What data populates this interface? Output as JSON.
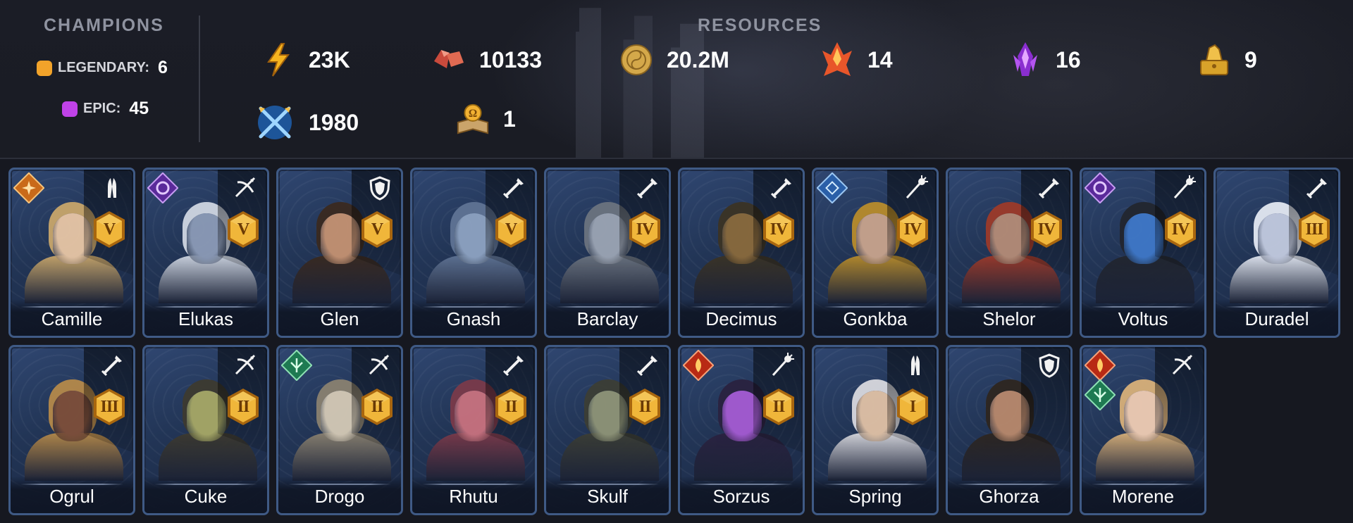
{
  "champions": {
    "title": "CHAMPIONS",
    "legendary_label": "LEGENDARY:",
    "legendary_count": "6",
    "epic_label": "EPIC:",
    "epic_count": "45",
    "legendary_color": "#f2a32a",
    "epic_color": "#c042e8"
  },
  "resources": {
    "title": "RESOURCES",
    "items": [
      {
        "icon": "energy-icon",
        "value": "23K"
      },
      {
        "icon": "ruby-icon",
        "value": "10133"
      },
      {
        "icon": "silver-coin-icon",
        "value": "20.2M"
      },
      {
        "icon": "sacred-shard-icon",
        "value": "14"
      },
      {
        "icon": "void-shard-icon",
        "value": "16"
      },
      {
        "icon": "gold-chest-icon",
        "value": "9"
      },
      {
        "icon": "arena-token-icon",
        "value": "1980"
      },
      {
        "icon": "tome-icon",
        "value": "1"
      }
    ]
  },
  "cards": [
    {
      "name": "Camille",
      "rank": "V",
      "class": "support-icon",
      "affinity": "force-icon",
      "skin": "#e9c7a6",
      "hair": "#c8a66b"
    },
    {
      "name": "Elukas",
      "rank": "V",
      "class": "crossbow-icon",
      "affinity": "magic-icon",
      "skin": "#8c9bb7",
      "hair": "#cfd6e2"
    },
    {
      "name": "Glen",
      "rank": "V",
      "class": "defense-icon",
      "affinity": "",
      "skin": "#c59272",
      "hair": "#3a2a20"
    },
    {
      "name": "Gnash",
      "rank": "V",
      "class": "attack-icon",
      "affinity": "",
      "skin": "#8ea3c2",
      "hair": "#5f7394"
    },
    {
      "name": "Barclay",
      "rank": "IV",
      "class": "attack-icon",
      "affinity": "",
      "skin": "#9ca5b4",
      "hair": "#6b737f"
    },
    {
      "name": "Decimus",
      "rank": "IV",
      "class": "attack-icon",
      "affinity": "",
      "skin": "#8a6a3c",
      "hair": "#3b3325"
    },
    {
      "name": "Gonkba",
      "rank": "IV",
      "class": "magic-staff-icon",
      "affinity": "spirit-icon",
      "skin": "#c9a48d",
      "hair": "#b88c2c"
    },
    {
      "name": "Shelor",
      "rank": "IV",
      "class": "attack-icon",
      "affinity": "",
      "skin": "#b58c77",
      "hair": "#9c3a2a"
    },
    {
      "name": "Voltus",
      "rank": "IV",
      "class": "magic-staff-icon",
      "affinity": "magic-icon",
      "skin": "#3f78c8",
      "hair": "#22262f"
    },
    {
      "name": "Duradel",
      "rank": "III",
      "class": "attack-icon",
      "affinity": "",
      "skin": "#c3cbe0",
      "hair": "#e3e8f2"
    },
    {
      "name": "Ogrul",
      "rank": "III",
      "class": "attack-icon",
      "affinity": "",
      "skin": "#7e4f3a",
      "hair": "#b5894a"
    },
    {
      "name": "Cuke",
      "rank": "II",
      "class": "crossbow-icon",
      "affinity": "",
      "skin": "#a7a866",
      "hair": "#3d3a30"
    },
    {
      "name": "Drogo",
      "rank": "II",
      "class": "crossbow-icon",
      "affinity": "force-green-icon",
      "skin": "#d5cab6",
      "hair": "#8a8170"
    },
    {
      "name": "Rhutu",
      "rank": "II",
      "class": "attack-icon",
      "affinity": "",
      "skin": "#c9727f",
      "hair": "#7a3a4a"
    },
    {
      "name": "Skulf",
      "rank": "II",
      "class": "attack-icon",
      "affinity": "",
      "skin": "#8f9477",
      "hair": "#3c3e35"
    },
    {
      "name": "Sorzus",
      "rank": "II",
      "class": "magic-staff-icon",
      "affinity": "fire-icon",
      "skin": "#a55bd3",
      "hair": "#2a2240"
    },
    {
      "name": "Spring",
      "rank": "I",
      "class": "support-icon",
      "affinity": "",
      "skin": "#e1c2a6",
      "hair": "#d8d8de"
    },
    {
      "name": "Ghorza",
      "rank": "",
      "class": "defense-icon",
      "affinity": "",
      "skin": "#b9896c",
      "hair": "#2e2620"
    },
    {
      "name": "Morene",
      "rank": "",
      "class": "crossbow-icon",
      "affinity": "fire-icon",
      "affinity2": "force-green-icon",
      "skin": "#f0cdb4",
      "hair": "#d8b07a"
    }
  ]
}
